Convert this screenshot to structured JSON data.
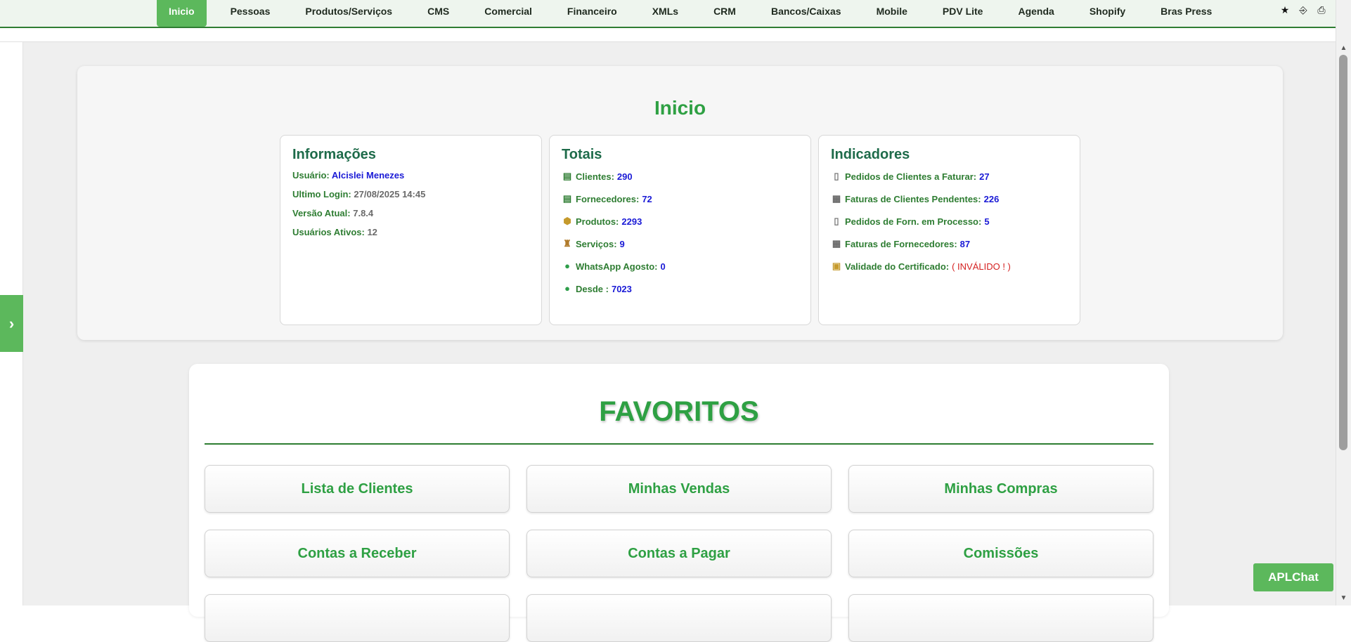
{
  "nav": {
    "items": [
      "Inicio",
      "Pessoas",
      "Produtos/Serviços",
      "CMS",
      "Comercial",
      "Financeiro",
      "XMLs",
      "CRM",
      "Bancos/Caixas",
      "Mobile",
      "PDV Lite",
      "Agenda",
      "Shopify",
      "Bras Press"
    ],
    "active": "Inicio",
    "tools": {
      "star": "★",
      "logout": "⎆",
      "print": "⎙"
    }
  },
  "sidebar": {
    "toggle": "›"
  },
  "page": {
    "title": "Inicio"
  },
  "info": {
    "heading": "Informações",
    "usuario_label": "Usuário:",
    "usuario_value": "Alcislei Menezes",
    "login_label": "Ultimo Login:",
    "login_value": "27/08/2025 14:45",
    "versao_label": "Versão Atual:",
    "versao_value": "7.8.4",
    "ativos_label": "Usuários Ativos:",
    "ativos_value": "12"
  },
  "totais": {
    "heading": "Totais",
    "rows": [
      {
        "label": "Clientes:",
        "value": "290",
        "icon": "database-icon"
      },
      {
        "label": "Fornecedores:",
        "value": "72",
        "icon": "database-icon"
      },
      {
        "label": "Produtos:",
        "value": "2293",
        "icon": "box-icon"
      },
      {
        "label": "Serviços:",
        "value": "9",
        "icon": "service-icon"
      },
      {
        "label": "WhatsApp Agosto:",
        "value": "0",
        "icon": "whatsapp-icon"
      },
      {
        "label": "Desde :",
        "value": "7023",
        "icon": "whatsapp-icon"
      }
    ]
  },
  "indicadores": {
    "heading": "Indicadores",
    "rows": [
      {
        "label": "Pedidos de Clientes a Faturar:",
        "value": "27",
        "icon": "document-icon"
      },
      {
        "label": "Faturas de Clientes Pendentes:",
        "value": "226",
        "icon": "invoice-icon"
      },
      {
        "label": "Pedidos de Forn. em Processo:",
        "value": "5",
        "icon": "document-icon"
      },
      {
        "label": "Faturas de Fornecedores:",
        "value": "87",
        "icon": "invoice-icon"
      },
      {
        "label": "Validade do Certificado:",
        "value": "( INVÁLIDO ! )",
        "icon": "lock-icon"
      }
    ]
  },
  "favoritos": {
    "title": "FAVORITOS",
    "buttons": [
      "Lista de Clientes",
      "Minhas Vendas",
      "Minhas Compras",
      "Contas a Receber",
      "Contas a Pagar",
      "Comissões"
    ]
  },
  "chat": {
    "label": "APLChat"
  },
  "colors": {
    "accent": "#5cb85c",
    "title_green": "#2ea043",
    "link_blue": "#1a1ad6",
    "warn_red": "#d42020"
  }
}
